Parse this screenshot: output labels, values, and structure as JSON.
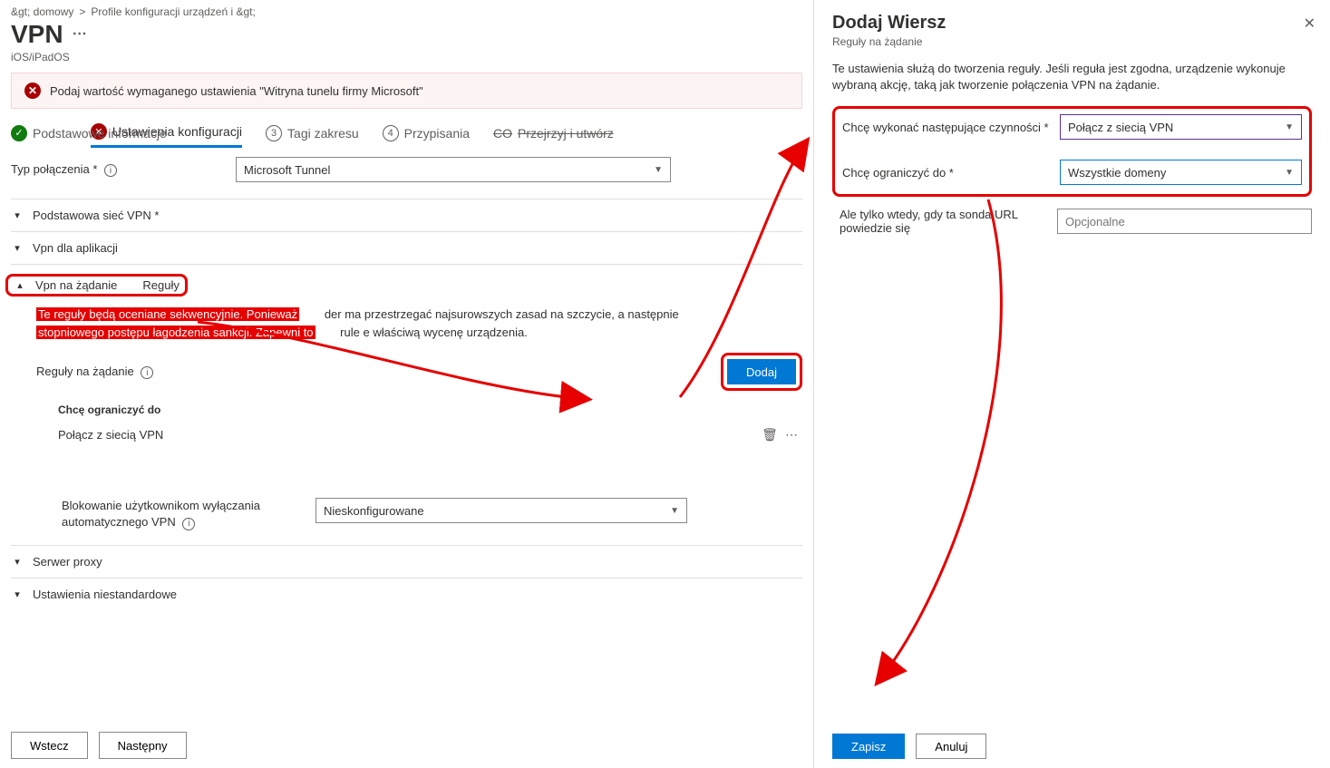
{
  "breadcrumb": {
    "home": "&gt; domowy",
    "sep": ">",
    "profiles": "Profile konfiguracji urządzeń i &gt;"
  },
  "header": {
    "title": "VPN",
    "subtitle": "iOS/iPadOS"
  },
  "error_banner": "Podaj wartość wymaganego ustawienia \"Witryna tunelu firmy Microsoft\"",
  "steps": {
    "s1": "Podstawowe informacje",
    "s2": "Ustawienia konfiguracji",
    "s3": "Tagi zakresu",
    "s3_num": "3",
    "s4": "Przypisania",
    "s4_num": "4",
    "s5_pre": "CO",
    "s5": "Przejrzyj i utwórz"
  },
  "conn_type": {
    "label": "Typ połączenia *",
    "value": "Microsoft Tunnel"
  },
  "sections": {
    "base_vpn": "Podstawowa sieć VPN *",
    "per_app": "Vpn dla aplikacji",
    "on_demand": "Vpn na żądanie",
    "on_demand_rules": "Reguły",
    "proxy": "Serwer proxy",
    "custom": "Ustawienia niestandardowe"
  },
  "on_demand": {
    "desc_highlight1": "Te reguły będą oceniane sekwencyjnie. Ponieważ",
    "desc_mid1": "der ma",
    "desc_plain1": "przestrzegać najsurowszych zasad na szczycie, a następnie",
    "desc_highlight2": "stopniowego postępu łagodzenia sankcji. Zapewni to",
    "desc_mid2": "rule e",
    "desc_plain2": "właściwą wycenę urządzenia.",
    "rules_label": "Reguły na żądanie",
    "add_btn": "Dodaj",
    "col1": "Chcę ograniczyć do",
    "row1": "Połącz z siecią VPN",
    "block_label": "Blokowanie użytkownikom wyłączania automatycznego VPN",
    "block_value": "Nieskonfigurowane"
  },
  "footer": {
    "prev": "Wstecz",
    "next": "Następny"
  },
  "side": {
    "title": "Dodaj Wiersz",
    "subtitle": "Reguły na żądanie",
    "desc": "Te ustawienia służą do tworzenia reguły. Jeśli reguła jest zgodna, urządzenie wykonuje wybraną akcję, taką jak tworzenie połączenia VPN na żądanie.",
    "row1_label": "Chcę wykonać następujące czynności *",
    "row1_value": "Połącz z siecią VPN",
    "row2_label": "Chcę ograniczyć do *",
    "row2_value": "Wszystkie domeny",
    "row3_label": "Ale tylko wtedy, gdy ta sonda URL powiedzie się",
    "row3_placeholder": "Opcjonalne",
    "save": "Zapisz",
    "cancel": "Anuluj"
  }
}
